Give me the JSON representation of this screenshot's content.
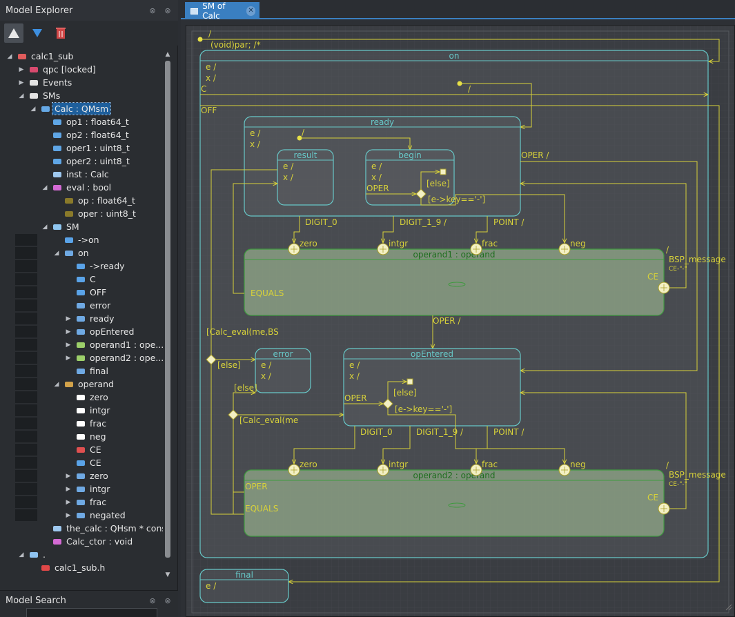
{
  "explorer": {
    "title": "Model Explorer",
    "tree": [
      {
        "label": "calc1_sub",
        "icon": "package-icon",
        "arrow": "expanded"
      },
      {
        "label": "qpc [locked]",
        "icon": "locked-package-icon",
        "arrow": "collapsed"
      },
      {
        "label": "Events",
        "icon": "folder-icon",
        "arrow": "collapsed"
      },
      {
        "label": "SMs",
        "icon": "folder-icon",
        "arrow": "expanded"
      },
      {
        "label": "Calc : QMsm",
        "icon": "class-icon",
        "arrow": "expanded",
        "selected": true
      },
      {
        "label": "op1 : float64_t",
        "icon": "attribute-icon"
      },
      {
        "label": "op2 : float64_t",
        "icon": "attribute-icon"
      },
      {
        "label": "oper1 : uint8_t",
        "icon": "attribute-icon"
      },
      {
        "label": "oper2 : uint8_t",
        "icon": "attribute-icon"
      },
      {
        "label": "inst : Calc",
        "icon": "static-attribute-icon"
      },
      {
        "label": "eval : bool",
        "icon": "operation-icon",
        "arrow": "expanded"
      },
      {
        "label": "op : float64_t",
        "icon": "parameter-icon"
      },
      {
        "label": "oper : uint8_t",
        "icon": "parameter-icon"
      },
      {
        "label": "SM",
        "icon": "state-machine-icon",
        "arrow": "expanded"
      },
      {
        "label": "->on",
        "icon": "initial-transition-icon"
      },
      {
        "label": "on",
        "icon": "state-icon",
        "arrow": "expanded"
      },
      {
        "label": "->ready",
        "icon": "initial-transition-icon"
      },
      {
        "label": "C",
        "icon": "transition-icon"
      },
      {
        "label": "OFF",
        "icon": "transition-icon"
      },
      {
        "label": "error",
        "icon": "state-icon"
      },
      {
        "label": "ready",
        "icon": "state-icon",
        "arrow": "collapsed"
      },
      {
        "label": "opEntered",
        "icon": "state-icon",
        "arrow": "collapsed"
      },
      {
        "label": "operand1 : ope...",
        "icon": "submachine-state-icon",
        "arrow": "collapsed"
      },
      {
        "label": "operand2 : ope...",
        "icon": "submachine-state-icon",
        "arrow": "collapsed"
      },
      {
        "label": "final",
        "icon": "state-icon"
      },
      {
        "label": "operand",
        "icon": "submachine-icon",
        "arrow": "expanded"
      },
      {
        "label": "zero",
        "icon": "entry-point-icon"
      },
      {
        "label": "intgr",
        "icon": "entry-point-icon"
      },
      {
        "label": "frac",
        "icon": "entry-point-icon"
      },
      {
        "label": "neg",
        "icon": "entry-point-icon"
      },
      {
        "label": "CE",
        "icon": "exit-point-icon"
      },
      {
        "label": "CE",
        "icon": "transition-icon"
      },
      {
        "label": "zero",
        "icon": "state-icon",
        "arrow": "collapsed"
      },
      {
        "label": "intgr",
        "icon": "state-icon",
        "arrow": "collapsed"
      },
      {
        "label": "frac",
        "icon": "state-icon",
        "arrow": "collapsed"
      },
      {
        "label": "negated",
        "icon": "state-icon",
        "arrow": "collapsed"
      },
      {
        "label": "the_calc : QHsm * const",
        "icon": "static-attribute-icon"
      },
      {
        "label": "Calc_ctor : void",
        "icon": "operation-icon"
      },
      {
        "label": ".",
        "icon": "directory-icon",
        "arrow": "expanded"
      },
      {
        "label": "calc1_sub.h",
        "icon": "file-icon"
      }
    ]
  },
  "search": {
    "title": "Model Search"
  },
  "editor": {
    "tab_label": "SM of Calc",
    "diagram": {
      "top_initial": {
        "line1": "/",
        "line2": "(void)par; /*"
      },
      "on": {
        "title": "on",
        "actions": [
          "e /",
          "x /"
        ],
        "c": "C",
        "off": "OFF",
        "init_label": "/",
        "oper_label": "OPER /"
      },
      "ready": {
        "title": "ready",
        "actions": [
          "e /",
          "x /"
        ],
        "init_label": "/"
      },
      "result": {
        "title": "result",
        "actions": [
          "e /",
          "x /"
        ]
      },
      "begin": {
        "title": "begin",
        "actions": [
          "e /",
          "x /"
        ],
        "oper": "OPER",
        "else": "[else]",
        "guard": "[e->key=='-']"
      },
      "ready_transitions": {
        "digit0": "DIGIT_0",
        "digit19": "DIGIT_1_9 /",
        "point": "POINT /"
      },
      "operand1": {
        "title": "operand1 : operand",
        "equals": "EQUALS",
        "ce": "CE",
        "bsp": "BSP_message",
        "bsp_slash": "/",
        "bsp_sub": "CE-\"-\"",
        "entries": [
          "zero",
          "intgr",
          "frac",
          "neg"
        ]
      },
      "operand1_oper": "OPER /",
      "calc_eval_top": "[Calc_eval(me,BS",
      "else_top": "[else]",
      "error": {
        "title": "error",
        "actions": [
          "e /",
          "x /"
        ],
        "else": "[else]"
      },
      "opentered": {
        "title": "opEntered",
        "actions": [
          "e /",
          "x /"
        ],
        "oper": "OPER",
        "else": "[else]",
        "guard": "[e->key=='-']"
      },
      "calc_eval_mid": "[Calc_eval(me",
      "op_transitions": {
        "digit0": "DIGIT_0",
        "digit19": "DIGIT_1_9 /",
        "point": "POINT /"
      },
      "operand2": {
        "title": "operand2 : operand",
        "oper": "OPER",
        "equals": "EQUALS",
        "ce": "CE",
        "bsp": "BSP_message",
        "bsp_slash": "/",
        "bsp_sub": "CE-\"-\"",
        "entries": [
          "zero",
          "intgr",
          "frac",
          "neg"
        ]
      },
      "final": {
        "title": "final",
        "actions": [
          "e /"
        ]
      }
    }
  },
  "colors": {
    "state_border": "#67c8c8",
    "state_fill": "#5a5d62",
    "submachine_border": "#3f9a3f",
    "submachine_fill": "#8a9e82",
    "transition": "#d8d23a",
    "submachine_text": "#1e6e1e",
    "accent": "#3a7fc1"
  }
}
